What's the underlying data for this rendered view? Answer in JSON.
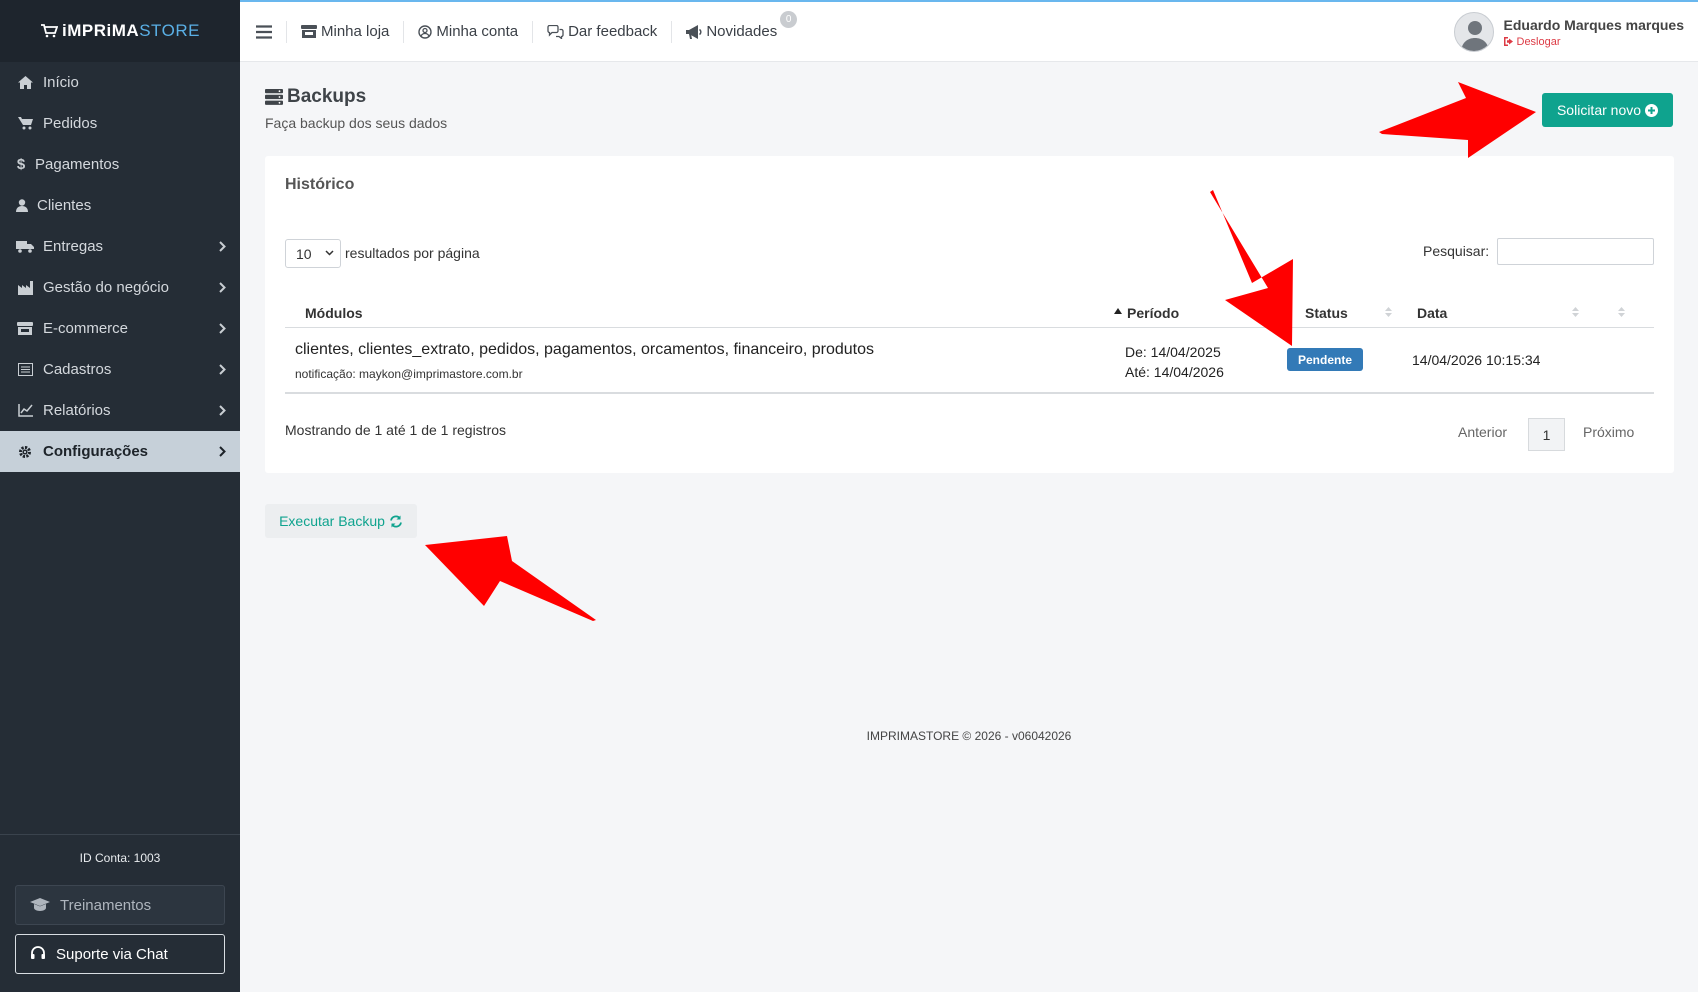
{
  "brand": {
    "prefix": "iMPRiMA",
    "suffix": "STORE"
  },
  "sidebar": {
    "items": [
      {
        "label": "Início",
        "icon": "home-icon"
      },
      {
        "label": "Pedidos",
        "icon": "cart-icon"
      },
      {
        "label": "Pagamentos",
        "icon": "dollar-icon"
      },
      {
        "label": "Clientes",
        "icon": "user-icon"
      },
      {
        "label": "Entregas",
        "icon": "truck-icon"
      },
      {
        "label": "Gestão do negócio",
        "icon": "building-icon"
      },
      {
        "label": "E-commerce",
        "icon": "store-icon"
      },
      {
        "label": "Cadastros",
        "icon": "list-icon"
      },
      {
        "label": "Relatórios",
        "icon": "chart-icon"
      },
      {
        "label": "Configurações",
        "icon": "gear-icon"
      }
    ],
    "account_id": "ID Conta: 1003",
    "training_label": "Treinamentos",
    "chat_label": "Suporte via Chat"
  },
  "topbar": {
    "minha_loja": "Minha loja",
    "minha_conta": "Minha conta",
    "feedback": "Dar feedback",
    "novidades": "Novidades",
    "novidades_count": "0",
    "user_name": "Eduardo Marques marques",
    "logout": "Deslogar"
  },
  "page": {
    "title": "Backups",
    "subtitle": "Faça backup dos seus dados",
    "new_button": "Solicitar novo"
  },
  "history": {
    "title": "Histórico",
    "page_length": "10",
    "page_length_label": "resultados por página",
    "search_label": "Pesquisar:",
    "columns": {
      "modules": "Módulos",
      "period": "Período",
      "status": "Status",
      "date": "Data"
    },
    "rows": [
      {
        "modules": "clientes, clientes_extrato, pedidos, pagamentos, orcamentos, financeiro, produtos",
        "notification": "notificação: maykon@imprimastore.com.br",
        "from": "De: 14/04/2025",
        "to": "Até: 14/04/2026",
        "status": "Pendente",
        "date": "14/04/2026 10:15:34"
      }
    ],
    "showing": "Mostrando de 1 até 1 de 1 registros",
    "prev": "Anterior",
    "page": "1",
    "next": "Próximo"
  },
  "exec_button": "Executar Backup",
  "footer": "IMPRIMASTORE © 2026 - v06042026",
  "colors": {
    "sidebar": "#252d36",
    "accent": "#0fa38e",
    "status": "#337ab7",
    "arrow": "#ff0000"
  }
}
